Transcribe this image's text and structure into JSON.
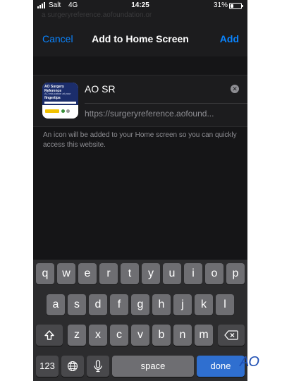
{
  "status_bar": {
    "carrier": "Salt",
    "network": "4G",
    "time": "14:25",
    "battery": "31%"
  },
  "background_url": "a surgeryreference.aofoundation.or",
  "nav": {
    "cancel_label": "Cancel",
    "title": "Add to Home Screen",
    "add_label": "Add"
  },
  "card": {
    "thumbnail": {
      "logo": "AO Surgery Reference",
      "line1": "AO education at your",
      "line2": "fingertips"
    },
    "name_value": "AO  SR",
    "url": "https://surgeryreference.aofound..."
  },
  "hint": "An icon will be added to your Home screen so you can quickly access this website.",
  "keyboard": {
    "row1": [
      "q",
      "w",
      "e",
      "r",
      "t",
      "y",
      "u",
      "i",
      "o",
      "p"
    ],
    "row2": [
      "a",
      "s",
      "d",
      "f",
      "g",
      "h",
      "j",
      "k",
      "l"
    ],
    "row3": [
      "z",
      "x",
      "c",
      "v",
      "b",
      "n",
      "m"
    ],
    "numbers_label": "123",
    "space_label": "space",
    "done_label": "done"
  },
  "watermark": "AO",
  "colors": {
    "accent": "#0a84ff",
    "done_key": "#2f6fd0",
    "watermark": "#1f4fb3"
  }
}
